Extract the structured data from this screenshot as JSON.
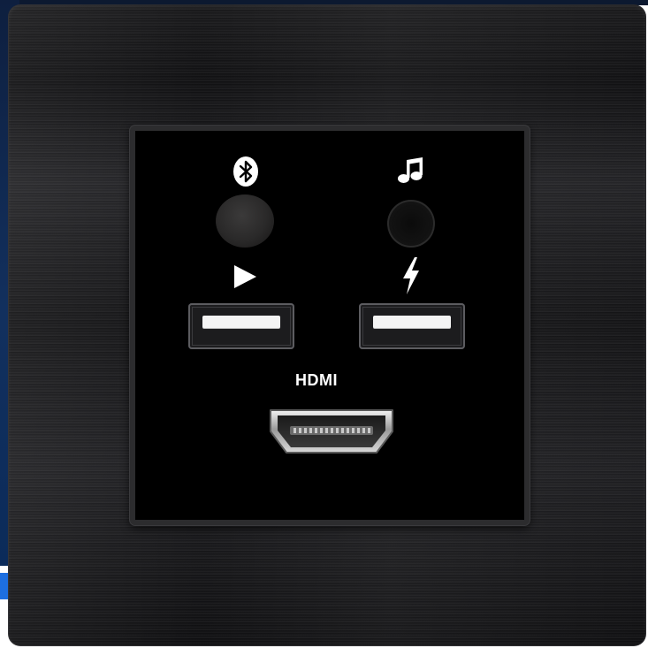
{
  "image": {
    "subject": "wall plate",
    "colors": {
      "plate": "#1a1a1c",
      "insert": "#000000",
      "usb_tongue": "#f4f4f4",
      "icon": "#ffffff",
      "background_accent": "#12305e"
    }
  },
  "panel": {
    "hdmi_label": "HDMI",
    "icons": {
      "top_left": "bluetooth-icon",
      "top_right": "music-note-icon",
      "mid_left": "play-icon",
      "mid_right": "charging-bolt-icon"
    }
  }
}
